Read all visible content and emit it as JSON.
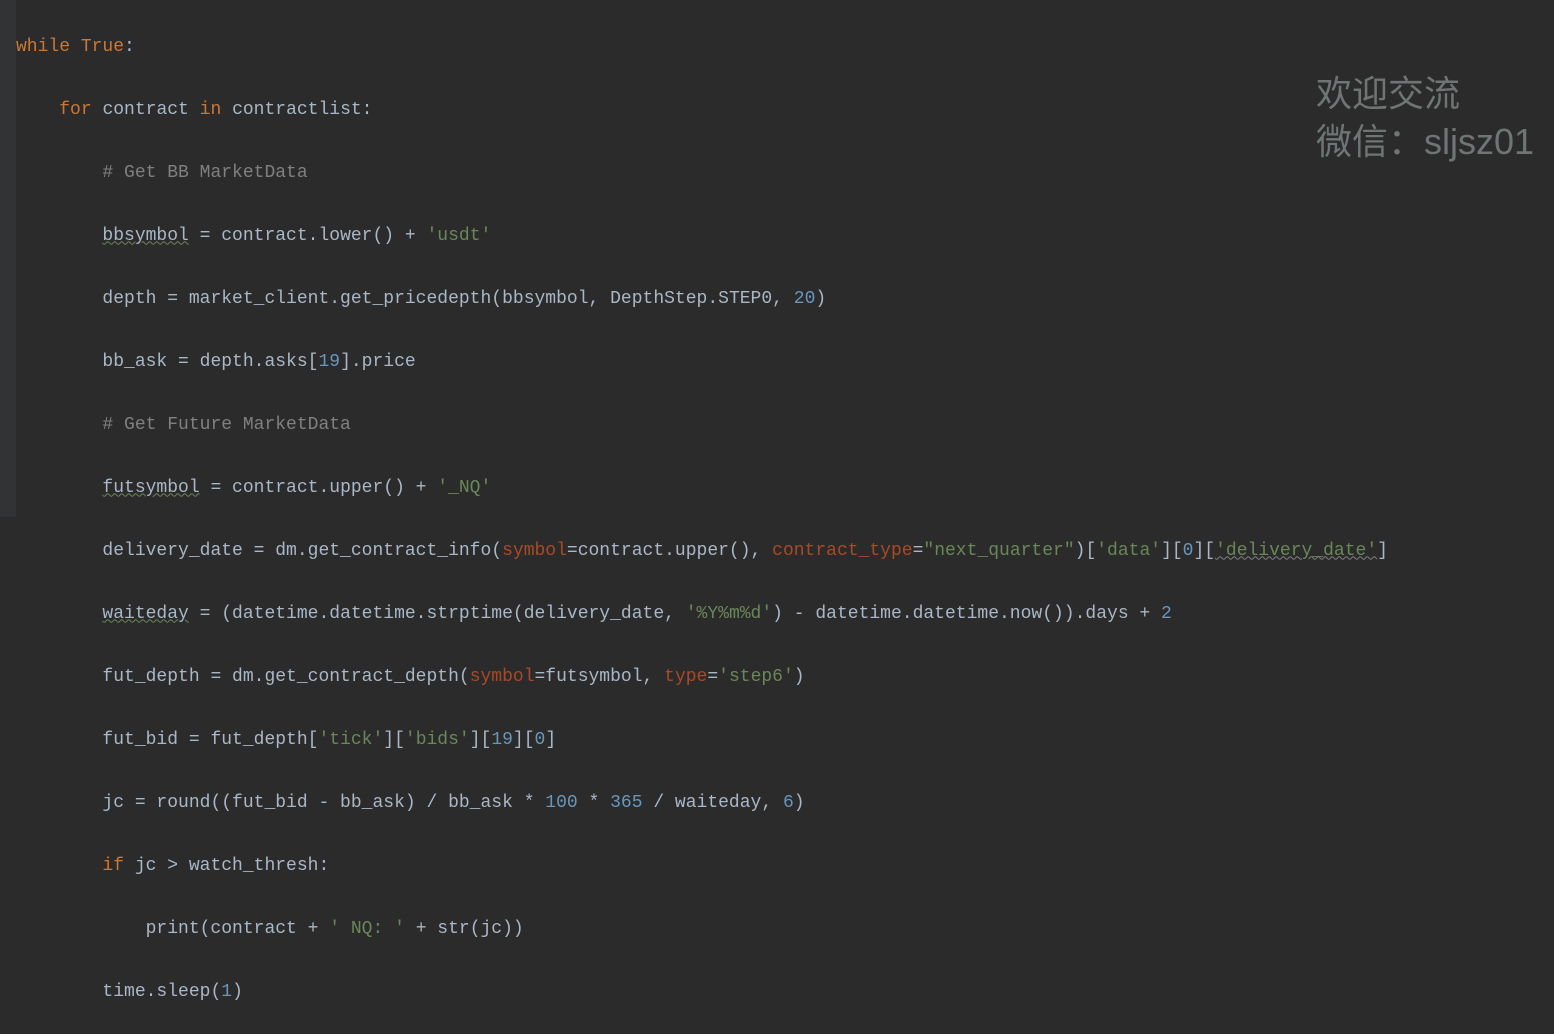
{
  "watermark": {
    "line1": "欢迎交流",
    "line2": "微信：sljsz01"
  },
  "code": {
    "l0": {
      "kw_while": "while ",
      "true": "True",
      "colon": ":"
    },
    "l1": {
      "kw_for": "for ",
      "var": "contract ",
      "kw_in": "in ",
      "iter": "contractlist:"
    },
    "l2": {
      "comment": "# Get BB MarketData"
    },
    "l3": {
      "lhs": "bbsymbol",
      "eq": " = contract.lower() + ",
      "str": "'usdt'"
    },
    "l4": {
      "lhs": "depth = market_client.get_pricedepth(bbsymbol",
      "comma": ", ",
      "arg2": "DepthStep.STEP0",
      "comma2": ", ",
      "num": "20",
      "close": ")"
    },
    "l5": {
      "text1": "bb_ask = depth.asks[",
      "idx": "19",
      "text2": "].price"
    },
    "l6": {
      "comment": "# Get Future MarketData"
    },
    "l7": {
      "lhs": "futsymbol",
      "mid": " = contract.upper() + ",
      "str": "'_NQ'"
    },
    "l8": {
      "a": "delivery_date = dm.get_contract_info(",
      "p1": "symbol",
      "b": "=contract.upper()",
      "c": ", ",
      "p2": "contract_type",
      "d": "=",
      "s1": "\"next_quarter\"",
      "e": ")[",
      "s2": "'data'",
      "f": "][",
      "n": "0",
      "g": "][",
      "s3": "'delivery_date'",
      "h": "]"
    },
    "l9": {
      "lhs": "waiteday",
      "a": " = (datetime.datetime.strptime(delivery_date",
      "c": ", ",
      "s": "'%Y%m%d'",
      "b": ") - datetime.datetime.now()).days + ",
      "n": "2"
    },
    "l10": {
      "a": "fut_depth = dm.get_contract_depth(",
      "p1": "symbol",
      "b": "=futsymbol",
      "c": ", ",
      "p2": "type",
      "d": "=",
      "s": "'step6'",
      "e": ")"
    },
    "l11": {
      "a": "fut_bid = fut_depth[",
      "s1": "'tick'",
      "b": "][",
      "s2": "'bids'",
      "c": "][",
      "n1": "19",
      "d": "][",
      "n2": "0",
      "e": "]"
    },
    "l12": {
      "a": "jc = round((fut_bid - bb_ask) / bb_ask * ",
      "n1": "100",
      "b": " * ",
      "n2": "365",
      "c": " / waiteday",
      "d": ", ",
      "n3": "6",
      "e": ")"
    },
    "l13": {
      "kw": "if ",
      "cond": "jc > watch_thresh:"
    },
    "l14": {
      "a": "print(contract + ",
      "s": "' NQ: '",
      "b": " + str(jc))"
    },
    "l15": {
      "a": "time.sleep(",
      "n": "1",
      "b": ")"
    }
  }
}
